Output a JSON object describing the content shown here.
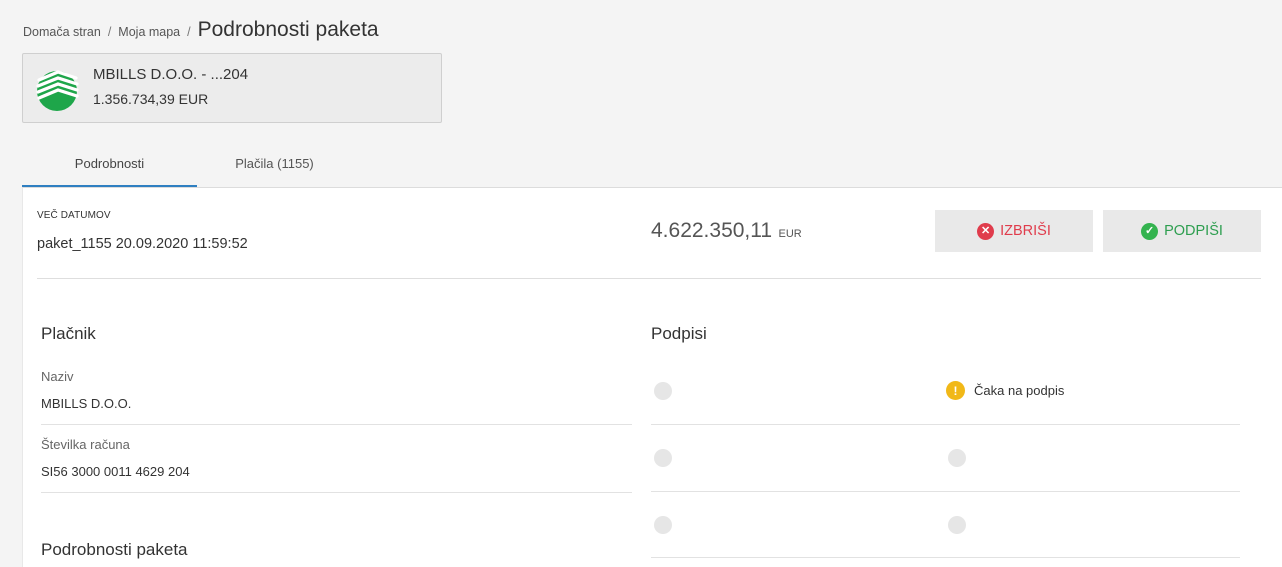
{
  "breadcrumb": {
    "home": "Domača stran",
    "folder": "Moja mapa",
    "current": "Podrobnosti paketa",
    "separator": "/"
  },
  "account": {
    "name": "MBILLS D.O.O. - ...204",
    "balance": "1.356.734,39 EUR",
    "logo_icon": "bank-logo-icon"
  },
  "tabs": [
    {
      "label": "Podrobnosti",
      "active": true
    },
    {
      "label": "Plačila (1155)",
      "active": false
    }
  ],
  "package": {
    "date_label": "VEČ DATUMOV",
    "name": "paket_1155 20.09.2020 11:59:52",
    "amount": "4.622.350,11",
    "currency": "EUR"
  },
  "actions": {
    "delete_label": "IZBRIŠI",
    "sign_label": "PODPIŠI",
    "delete_icon": "close-circle-icon",
    "sign_icon": "check-circle-icon"
  },
  "payer": {
    "title": "Plačnik",
    "fields": [
      {
        "label": "Naziv",
        "value": "MBILLS D.O.O."
      },
      {
        "label": "Številka računa",
        "value": "SI56 3000 0011 4629 204"
      }
    ]
  },
  "signatures": {
    "title": "Podpisi",
    "status_label": "Čaka na podpis",
    "status_icon": "warning-circle-icon"
  },
  "details": {
    "title": "Podrobnosti paketa"
  },
  "colors": {
    "accent_tab": "#2f7fc1",
    "delete": "#e03c4c",
    "sign": "#34b34f",
    "warning": "#f1b818",
    "logo_green": "#1ea64a"
  }
}
